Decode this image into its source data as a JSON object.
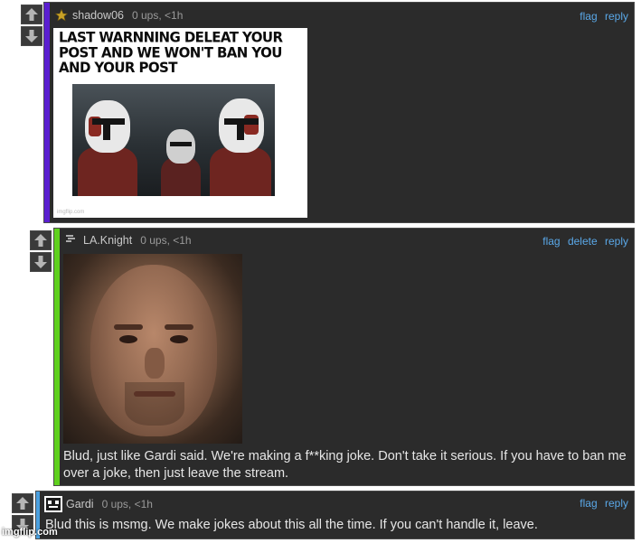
{
  "comments": [
    {
      "username": "shadow06",
      "meta": "0 ups, <1h",
      "actions": [
        "flag",
        "reply"
      ],
      "bar_color": "#5a1fd0",
      "user_icon": "star-badge-icon",
      "meme": {
        "caption": "LAST WARNNING DELEAT YOUR POST AND WE WON'T BAN YOU AND YOUR POST",
        "watermark": "imgflip.com"
      }
    },
    {
      "username": "LA.Knight",
      "meta": "0 ups, <1h",
      "actions": [
        "flag",
        "delete",
        "reply"
      ],
      "bar_color": "#5fd01e",
      "user_icon": "rank-badge-icon",
      "text": "Blud, just like Gardi said. We're making a f**king joke. Don't take it serious. If you have to ban me over a joke, then just leave the stream."
    },
    {
      "username": "Gardi",
      "meta": "0 ups, <1h",
      "actions": [
        "flag",
        "reply"
      ],
      "bar_color": "#4aa0e0",
      "user_icon": "pixel-avatar-icon",
      "text": "Blud this is msmg. We make jokes about this all the time. If you can't handle it, leave."
    }
  ],
  "watermark": "imgflip.com"
}
